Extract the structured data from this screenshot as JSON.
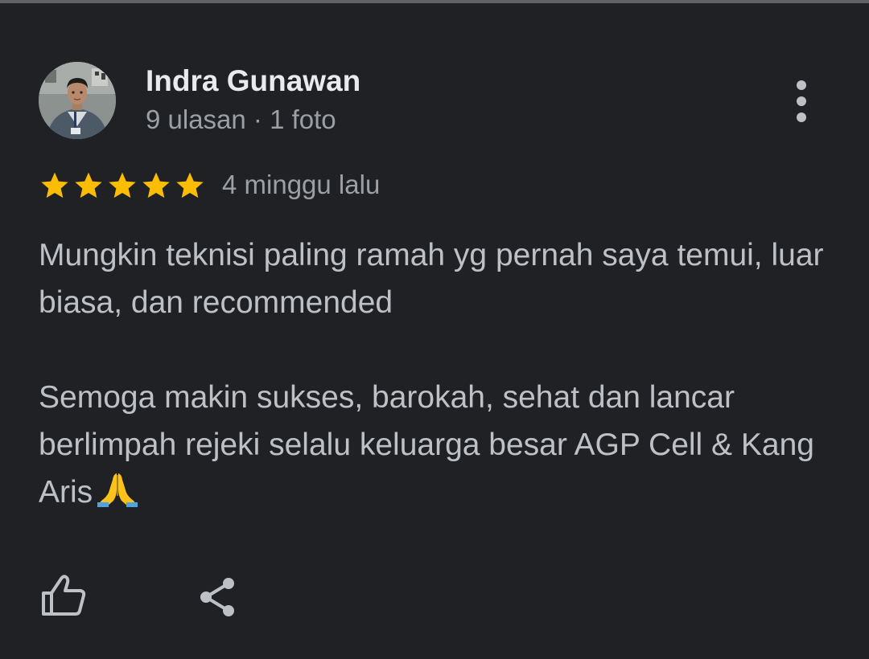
{
  "reviewer": {
    "name": "Indra Gunawan",
    "meta": "9 ulasan · 1 foto"
  },
  "rating": {
    "stars": 5,
    "max": 5,
    "star_color": "#fbbc04"
  },
  "review": {
    "time": "4 minggu lalu",
    "paragraph_1": "Mungkin teknisi paling ramah yg pernah saya temui, luar biasa, dan recommended",
    "paragraph_2": "Semoga makin sukses, barokah, sehat dan lancar berlimpah rejeki selalu keluarga besar AGP Cell & Kang Aris"
  },
  "icons": {
    "avatar": "avatar-photo",
    "more": "more-vert-icon",
    "emoji": "folded-hands-emoji",
    "like": "thumbs-up-icon",
    "share": "share-icon"
  },
  "theme": {
    "background": "#202124",
    "text_primary": "#e8eaed",
    "text_secondary": "#9aa0a6",
    "text_body": "#bdc1c6"
  }
}
